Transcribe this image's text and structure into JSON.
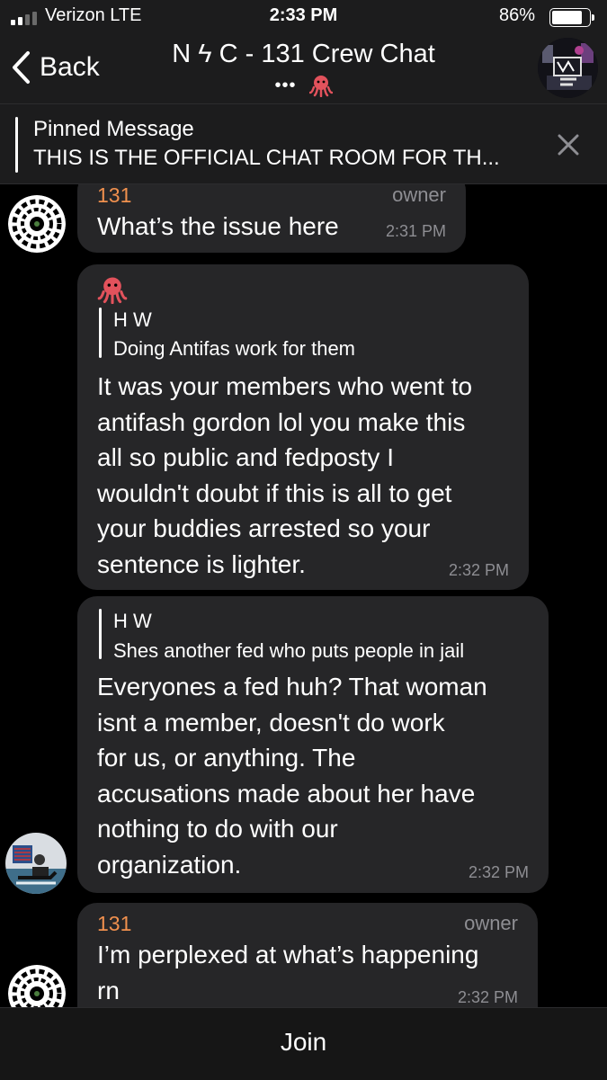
{
  "status_bar": {
    "carrier": "Verizon  LTE",
    "time": "2:33 PM",
    "battery": "86%",
    "battery_level": 0.86
  },
  "nav": {
    "back_label": "Back",
    "title": "N ϟ C - 131 Crew Chat",
    "subtitle_dots": "•••",
    "subtitle_emoji": "octopus-icon",
    "avatar": "group-avatar-image"
  },
  "pinned": {
    "title": "Pinned Message",
    "text": "THIS IS THE OFFICIAL CHAT ROOM FOR TH..."
  },
  "messages": [
    {
      "sender": "131",
      "role": "owner",
      "text": "What’s the issue here",
      "time": "2:31 PM",
      "avatar": "black-sun-avatar"
    },
    {
      "sender_emoji": "octopus-icon",
      "reply": {
        "name": "H W",
        "text": "Doing Antifas work for them"
      },
      "lines": [
        "It was your members who went to",
        "antifash gordon lol you make this",
        "all so public and fedposty I",
        "wouldn't doubt if this is all to get",
        "your buddies arrested so your",
        "sentence is lighter."
      ],
      "time": "2:32 PM"
    },
    {
      "reply": {
        "name": "H W",
        "text": "Shes another fed who puts people in jail"
      },
      "lines": [
        "Everyones a fed huh? That woman",
        "isnt a member, doesn't do work",
        "for us, or anything. The",
        "accusations made about her have",
        "nothing to do with our",
        "organization."
      ],
      "time": "2:32 PM",
      "avatar": "photo-avatar"
    },
    {
      "sender": "131",
      "role": "owner",
      "lines": [
        "I’m perplexed at what’s happening",
        "rn"
      ],
      "time": "2:32 PM",
      "avatar": "black-sun-avatar"
    }
  ],
  "join_label": "Join",
  "colors": {
    "background": "#000000",
    "bar": "#1c1c1d",
    "bubble": "#262628",
    "sender": "#f0904e",
    "meta": "#8e8e93"
  }
}
